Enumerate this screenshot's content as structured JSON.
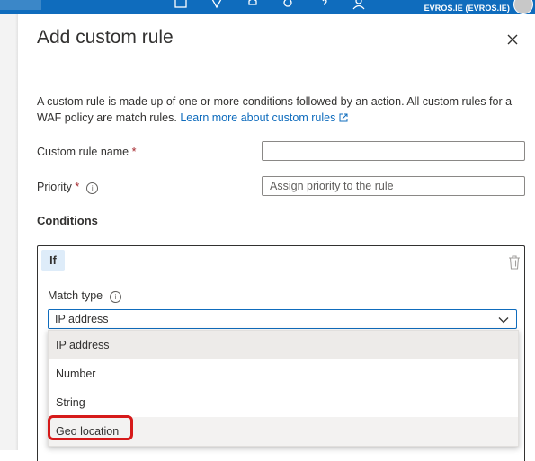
{
  "topbar": {
    "user": "EVROS.IE (EVROS.IE)",
    "icons": [
      "feedback-icon",
      "settings-gear-icon",
      "bell-icon",
      "gear-icon",
      "help-icon",
      "person-icon"
    ],
    "color": "#0f6cbd"
  },
  "panel": {
    "title": "Add custom rule",
    "description": "A custom rule is made up of one or more conditions followed by an action. All custom rules for a WAF policy are match rules.",
    "learn_more": "Learn more about custom rules",
    "fields": {
      "rule_name_label": "Custom rule name",
      "required_mark": "*",
      "priority_label": "Priority",
      "priority_placeholder": "Assign priority to the rule"
    },
    "conditions": {
      "heading": "Conditions",
      "if_badge": "If",
      "match_type_label": "Match type",
      "selected_value": "IP address",
      "options": [
        "IP address",
        "Number",
        "String",
        "Geo location"
      ],
      "highlighted_option": "Geo location"
    }
  },
  "colors": {
    "accent": "#0f6cbd",
    "required": "#a4262c",
    "highlight_box": "#d61a1a"
  }
}
